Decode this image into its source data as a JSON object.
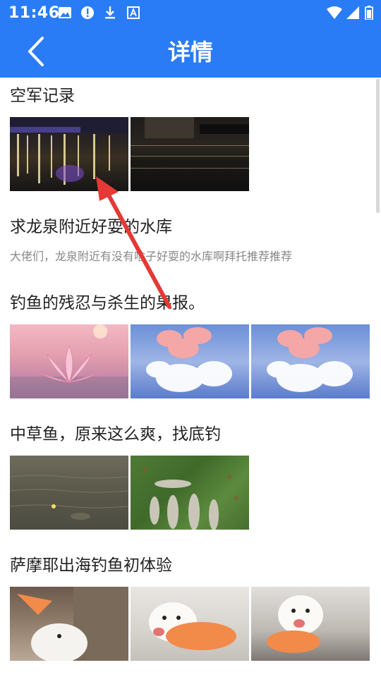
{
  "status_bar": {
    "time": "11:46",
    "icons": [
      "image-icon",
      "alert-icon",
      "download-icon",
      "a-badge-icon",
      "wifi-icon",
      "signal-icon",
      "battery-icon"
    ]
  },
  "app_bar": {
    "title": "详情",
    "back_icon": "chevron-left-icon",
    "color": "#2a7cf6"
  },
  "posts": [
    {
      "title": "空军记录",
      "desc": "",
      "images": [
        "night-river-lights",
        "night-river-dark"
      ]
    },
    {
      "title": "求龙泉附近好耍的水库",
      "desc": "大佬们，龙泉附近有没有啥子好耍的水库啊拜托推荐推荐",
      "images": []
    },
    {
      "title": "钓鱼的残忍与杀生的果报。",
      "desc": "",
      "images": [
        "lotus-sunset",
        "lotus-blue",
        "lotus-blue"
      ]
    },
    {
      "title": "中草鱼，原来这么爽，找底钓",
      "desc": "",
      "images": [
        "fish-water",
        "fish-on-grass"
      ]
    },
    {
      "title": "萨摩耶出海钓鱼初体验",
      "desc": "",
      "images": [
        "samoyed-boat",
        "samoyed-vest",
        "samoyed-seat"
      ]
    }
  ],
  "annotation": {
    "type": "arrow",
    "color": "#e53935"
  }
}
